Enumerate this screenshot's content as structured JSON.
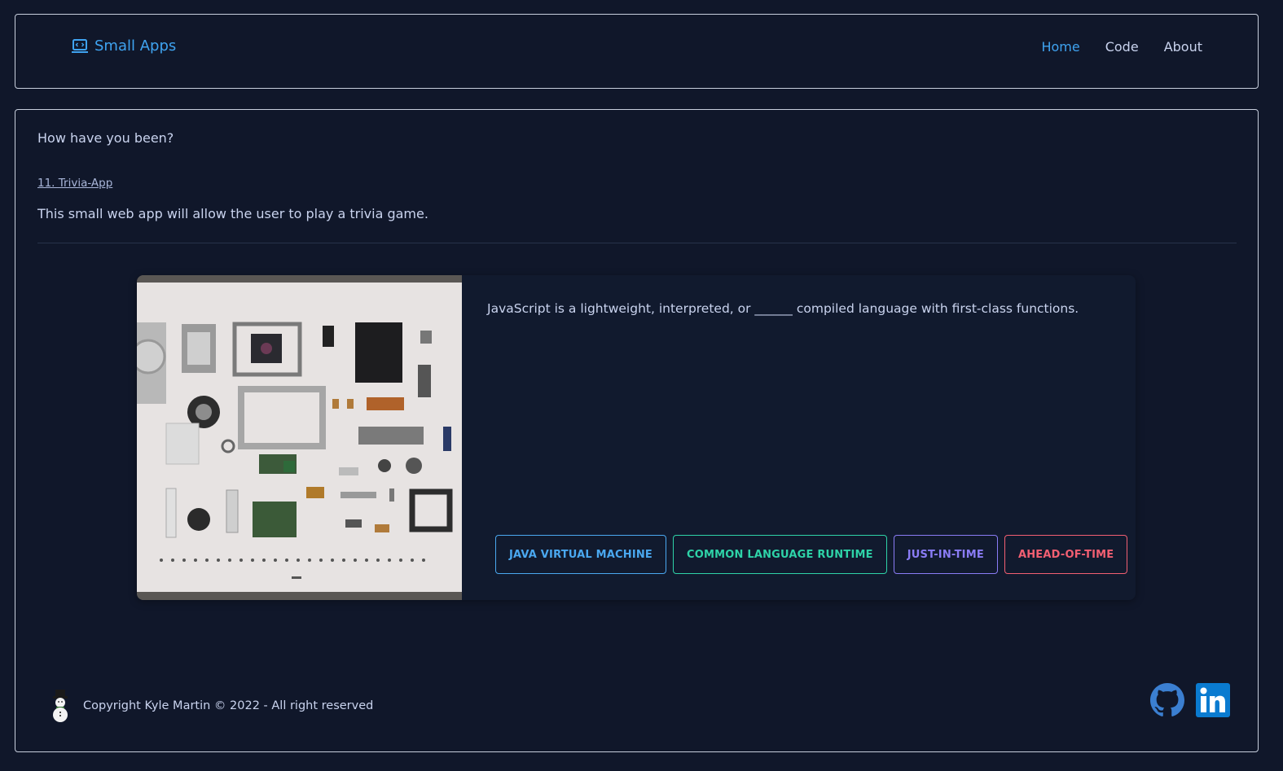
{
  "navbar": {
    "brand": "Small Apps",
    "links": [
      "Home",
      "Code",
      "About"
    ]
  },
  "main": {
    "greeting": "How have you been?",
    "app_link": "11. Trivia-App",
    "app_description": "This small web app will allow the user to play a trivia game."
  },
  "trivia": {
    "question": "JavaScript is a lightweight, interpreted, or ______ compiled language with first-class functions.",
    "answers": [
      "JAVA VIRTUAL MACHINE",
      "COMMON LANGUAGE RUNTIME",
      "JUST-IN-TIME",
      "AHEAD-OF-TIME"
    ]
  },
  "footer": {
    "copyright": "Copyright Kyle Martin © 2022 - All right reserved"
  },
  "colors": {
    "background": "#10172a",
    "accent": "#3fa3f0",
    "answer_blue": "#4aa8f0",
    "answer_teal": "#2ed3a8",
    "answer_purple": "#8a7cf5",
    "answer_red": "#f25f72"
  },
  "icons": [
    "laptop-code-icon",
    "snowman-icon",
    "github-icon",
    "linkedin-icon"
  ]
}
